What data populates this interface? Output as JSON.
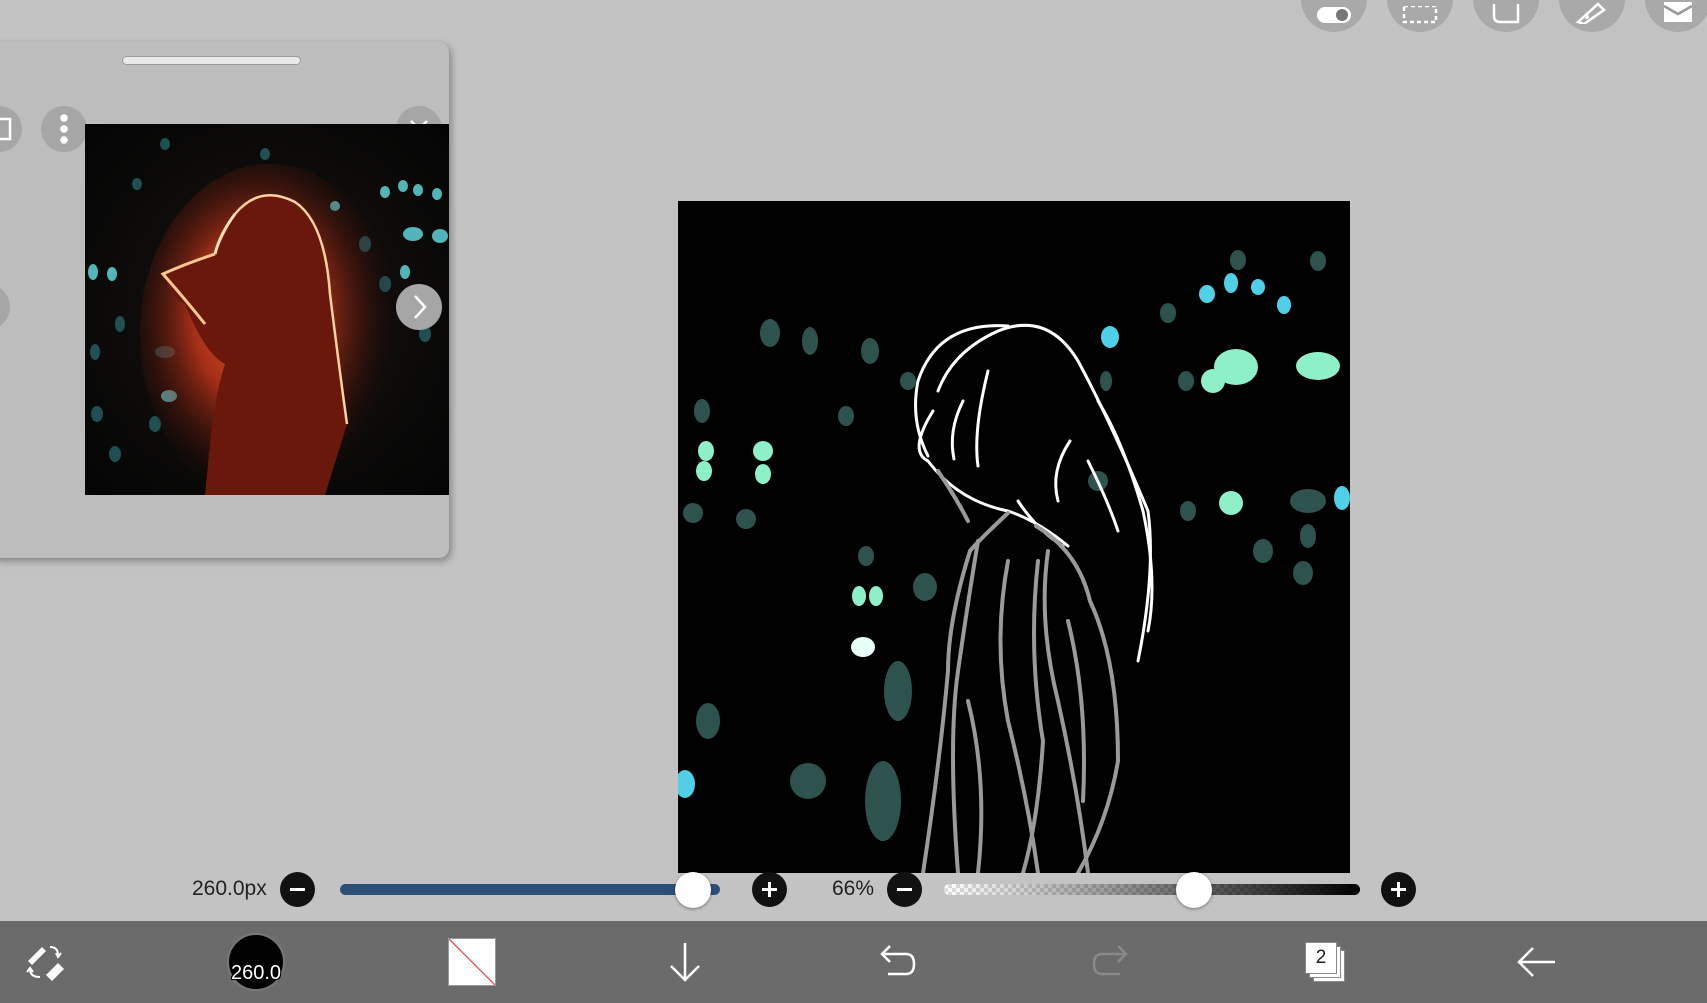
{
  "top_toolbar": {
    "icons": [
      "toggle-icon",
      "selection-icon",
      "shape-icon",
      "ruler-icon",
      "filter-icon"
    ]
  },
  "reference_window": {
    "icons": [
      "layer-icon",
      "more-vertical-icon",
      "close-icon",
      "prev-arrow-icon",
      "next-arrow-icon"
    ]
  },
  "canvas": {
    "background": "#000000",
    "bokeh_colors": [
      "#4fd0e8",
      "#8ef0c8",
      "#3e6f6a"
    ]
  },
  "brush_size": {
    "label": "260.0px",
    "fraction": 0.93
  },
  "opacity": {
    "label": "66%",
    "fraction": 0.6
  },
  "bottom_toolbar": {
    "brush_size_value": "260.0",
    "layer_count": "2",
    "icons": [
      "brush-eraser-swap-icon",
      "brush-preview",
      "color-swatch",
      "download-icon",
      "undo-icon",
      "redo-icon",
      "layers-icon",
      "back-icon"
    ]
  },
  "colors": {
    "accent": "#2d4f77",
    "toolbar": "#6b6b6b",
    "workspace": "#c3c3c3"
  }
}
